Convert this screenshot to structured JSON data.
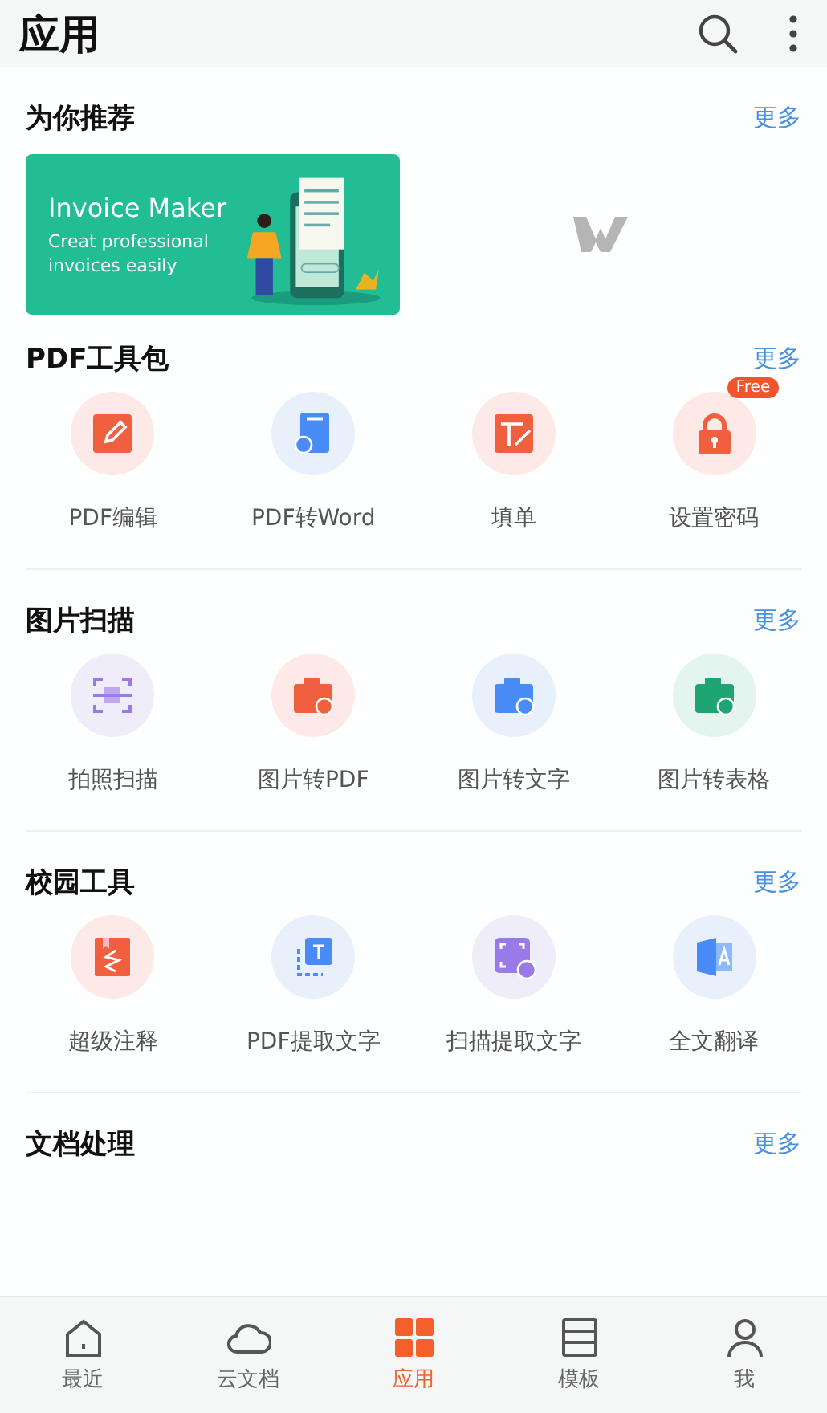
{
  "app_bar": {
    "title": "应用"
  },
  "recommend": {
    "title": "为你推荐",
    "more": "更多",
    "banner": {
      "title": "Invoice Maker",
      "subtitle": "Creat professional invoices easily"
    }
  },
  "sections": [
    {
      "title": "PDF工具包",
      "more": "更多",
      "items": [
        {
          "kind": "edit",
          "label": "PDF编辑"
        },
        {
          "kind": "word",
          "label": "PDF转Word"
        },
        {
          "kind": "form",
          "label": "填单"
        },
        {
          "kind": "lock",
          "label": "设置密码",
          "badge": "Free"
        }
      ]
    },
    {
      "title": "图片扫描",
      "more": "更多",
      "items": [
        {
          "kind": "scan",
          "label": "拍照扫描"
        },
        {
          "kind": "camera_red",
          "label": "图片转PDF"
        },
        {
          "kind": "camera_blue",
          "label": "图片转文字"
        },
        {
          "kind": "camera_green",
          "label": "图片转表格"
        }
      ]
    },
    {
      "title": "校园工具",
      "more": "更多",
      "items": [
        {
          "kind": "annotate",
          "label": "超级注释"
        },
        {
          "kind": "extract",
          "label": "PDF提取文字"
        },
        {
          "kind": "scan_text",
          "label": "扫描提取文字"
        },
        {
          "kind": "translate",
          "label": "全文翻译"
        }
      ]
    },
    {
      "title": "文档处理",
      "more": "更多"
    }
  ],
  "tabs": [
    {
      "kind": "home",
      "label": "最近",
      "selected": false
    },
    {
      "kind": "cloud",
      "label": "云文档",
      "selected": false
    },
    {
      "kind": "apps",
      "label": "应用",
      "selected": true
    },
    {
      "kind": "template",
      "label": "模板",
      "selected": false
    },
    {
      "kind": "me",
      "label": "我",
      "selected": false
    }
  ]
}
